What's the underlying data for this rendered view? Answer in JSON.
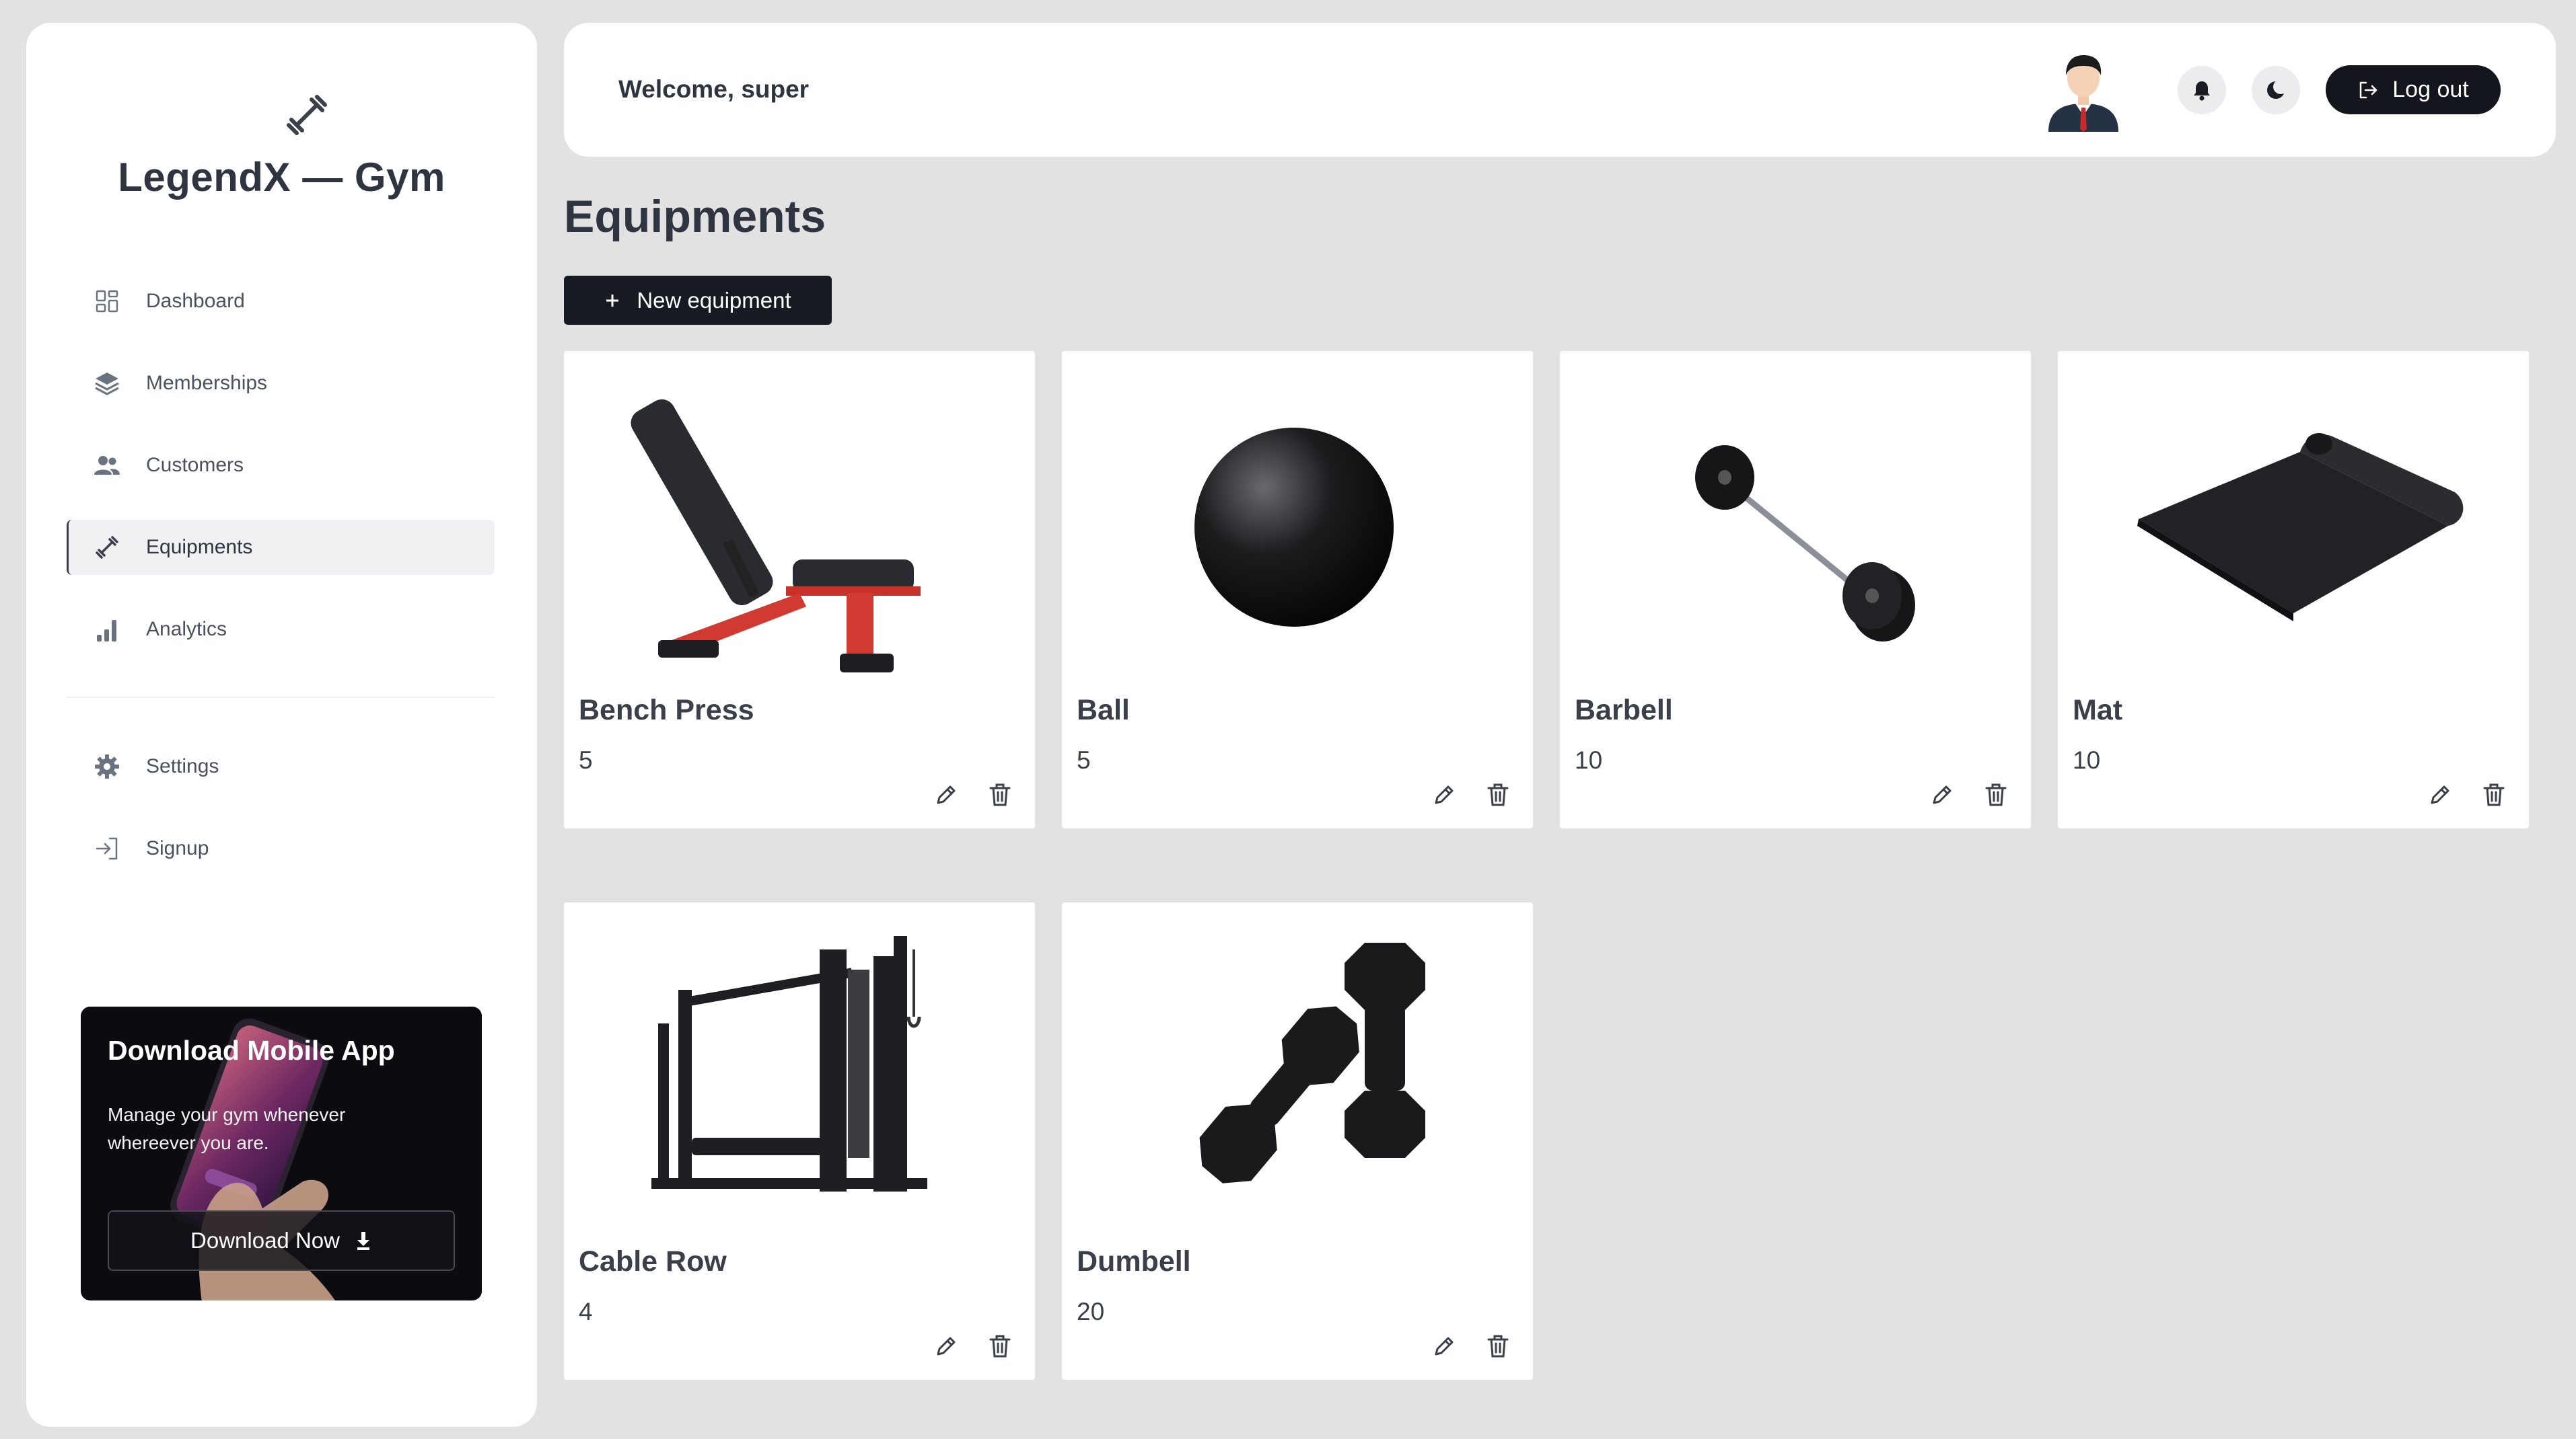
{
  "sidebar": {
    "brand": "LegendX — Gym",
    "items": [
      {
        "label": "Dashboard",
        "icon": "dashboard-icon"
      },
      {
        "label": "Memberships",
        "icon": "layers-icon"
      },
      {
        "label": "Customers",
        "icon": "users-icon"
      },
      {
        "label": "Equipments",
        "icon": "dumbbell-icon",
        "active": true
      },
      {
        "label": "Analytics",
        "icon": "bar-chart-icon"
      },
      {
        "label": "Settings",
        "icon": "gear-icon"
      },
      {
        "label": "Signup",
        "icon": "sign-in-icon"
      }
    ],
    "promo": {
      "title": "Download Mobile App",
      "text": "Manage your gym whenever whereever you are.",
      "button": "Download Now"
    }
  },
  "header": {
    "welcome": "Welcome, super",
    "logout": "Log out"
  },
  "main": {
    "title": "Equipments",
    "new_button": "New equipment",
    "equipment": [
      {
        "name": "Bench Press",
        "quantity": "5"
      },
      {
        "name": "Ball",
        "quantity": "5"
      },
      {
        "name": "Barbell",
        "quantity": "10"
      },
      {
        "name": "Mat",
        "quantity": "10"
      },
      {
        "name": "Cable Row",
        "quantity": "4"
      },
      {
        "name": "Dumbell",
        "quantity": "20"
      }
    ]
  },
  "colors": {
    "background": "#e2e2e2",
    "panel": "#ffffff",
    "primary_dark": "#161a21",
    "text": "#2f3540",
    "active_nav": "#f1f1f3"
  }
}
